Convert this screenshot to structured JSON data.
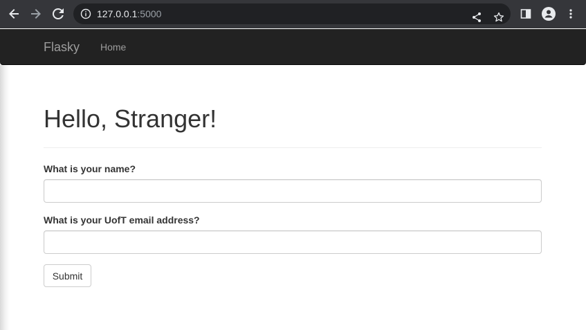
{
  "browser": {
    "url_host": "127.0.0.1",
    "url_port": ":5000",
    "icons": {
      "back": "arrow-left-icon",
      "forward": "arrow-right-icon",
      "reload": "reload-icon",
      "site_info": "info-icon",
      "share": "share-icon",
      "bookmark": "star-icon",
      "side_panel": "side-panel-icon",
      "profile": "profile-icon",
      "menu": "kebab-menu-icon"
    }
  },
  "navbar": {
    "brand": "Flasky",
    "links": [
      {
        "label": "Home"
      }
    ]
  },
  "main": {
    "title": "Hello, Stranger!",
    "form": {
      "name_label": "What is your name?",
      "name_value": "",
      "email_label": "What is your UofT email address?",
      "email_value": "",
      "submit_label": "Submit"
    }
  },
  "colors": {
    "chrome_bg": "#35363a",
    "omnibox_bg": "#202124",
    "navbar_bg": "#222222",
    "navbar_text": "#9d9d9d",
    "text": "#333333",
    "input_border": "#cccccc"
  }
}
